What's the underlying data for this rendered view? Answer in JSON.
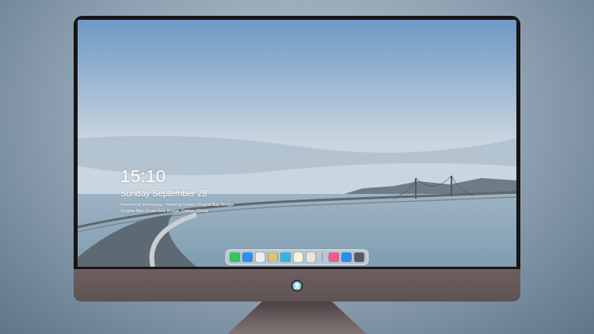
{
  "screen": {
    "clock": {
      "time": "15:10",
      "date": "Sunday September 28"
    },
    "caption": [
      "Interesting technology. Amazing Dalian Xinghai Bay Bridge",
      "Xinghai Bay Cross-Sea Bridge, Dalian, China"
    ]
  },
  "dock": {
    "groups": [
      [
        {
          "color": "#34c759"
        },
        {
          "color": "#2d8ff0"
        },
        {
          "color": "#eeeeee"
        },
        {
          "color": "#d6c27a"
        },
        {
          "color": "#36b4e8"
        },
        {
          "color": "#f7f2df"
        },
        {
          "color": "#e9e5dc"
        }
      ],
      [
        {
          "color": "#f25b8e"
        },
        {
          "color": "#2d8cf0"
        },
        {
          "color": "#5a5a5a"
        }
      ]
    ]
  }
}
